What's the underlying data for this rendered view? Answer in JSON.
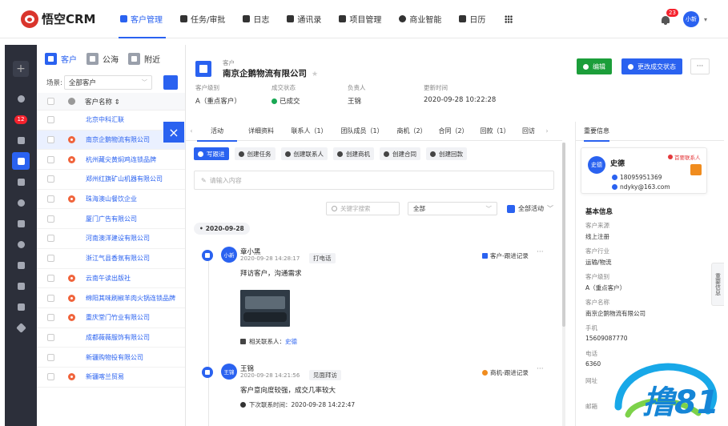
{
  "topnav": {
    "brand": "悟空CRM",
    "items": [
      {
        "label": "客户管理",
        "active": true
      },
      {
        "label": "任务/审批",
        "active": false
      },
      {
        "label": "日志",
        "active": false
      },
      {
        "label": "通讯录",
        "active": false
      },
      {
        "label": "项目管理",
        "active": false
      },
      {
        "label": "商业智能",
        "active": false
      },
      {
        "label": "日历",
        "active": false
      }
    ],
    "notification_count": "23",
    "user_avatar": "小新"
  },
  "sidebar": {
    "badge": "12",
    "icons": [
      "plus-icon",
      "dashboard-icon",
      "badge",
      "transfer-icon",
      "customer-icon",
      "contract-icon",
      "money-icon",
      "invoice-icon",
      "product-icon",
      "ledger-icon",
      "home-icon",
      "box-icon",
      "send-icon"
    ]
  },
  "listpanel": {
    "tabs": [
      "客户",
      "公海",
      "附近"
    ],
    "filter_label": "场景:",
    "filter_value": "全部客户",
    "column_header": "客户名称 ⇕",
    "rows": [
      {
        "name": "北京中科汇联",
        "flag": false,
        "selected": false
      },
      {
        "name": "南京企鹅物流有限公司",
        "flag": true,
        "selected": true
      },
      {
        "name": "杭州藏尖黄焖鸡连锁品牌",
        "flag": true,
        "selected": false
      },
      {
        "name": "郑州红旗矿山机器有限公司",
        "flag": false,
        "selected": false
      },
      {
        "name": "珠海澳山餐饮企业",
        "flag": true,
        "selected": false
      },
      {
        "name": "厦门广告有限公司",
        "flag": false,
        "selected": false
      },
      {
        "name": "河南澳洋建设有限公司",
        "flag": false,
        "selected": false
      },
      {
        "name": "浙江气县香氛有限公司",
        "flag": false,
        "selected": false
      },
      {
        "name": "云南午读出版社",
        "flag": true,
        "selected": false
      },
      {
        "name": "绵阳其味刷椒羊肉火锅连锁品牌",
        "flag": true,
        "selected": false
      },
      {
        "name": "重庆堂门竹业有限公司",
        "flag": true,
        "selected": false
      },
      {
        "name": "成都薇薇服饰有限公司",
        "flag": false,
        "selected": false
      },
      {
        "name": "新疆购物投有限公司",
        "flag": false,
        "selected": false
      },
      {
        "name": "新疆喀兰贸易",
        "flag": true,
        "selected": false
      }
    ],
    "close_icon": "×"
  },
  "detail": {
    "type_label": "客户",
    "name": "南京企鹅物流有限公司",
    "star": "★",
    "fields": [
      {
        "label": "客户级别",
        "value": "A（重点客户）"
      },
      {
        "label": "成交状态",
        "value": "已成交"
      },
      {
        "label": "负责人",
        "value": "王锦"
      },
      {
        "label": "更新时间",
        "value": "2020-09-28 10:22:28"
      }
    ],
    "edit_label": "编辑",
    "status_label": "更改成交状态",
    "more_label": "···",
    "tabs": [
      {
        "label": "活动",
        "active": true
      },
      {
        "label": "详细资料",
        "active": false
      },
      {
        "label": "联系人（1）",
        "active": false
      },
      {
        "label": "团队成员（1）",
        "active": false
      },
      {
        "label": "商机（2）",
        "active": false
      },
      {
        "label": "合同（2）",
        "active": false
      },
      {
        "label": "回款（1）",
        "active": false
      },
      {
        "label": "回访",
        "active": false
      }
    ],
    "actions": [
      "写跟进",
      "创建任务",
      "创建联系人",
      "创建商机",
      "创建合同",
      "创建回款"
    ],
    "note_placeholder": "请输入内容",
    "keyword_placeholder": "关键字搜索",
    "all_select": "全部",
    "all_activities": "全部活动",
    "date_pill": "2020-09-28",
    "feeds": [
      {
        "avatar": "小新",
        "user": "章小黑",
        "time": "2020-09-28 14:28:17",
        "tag": "打电话",
        "content": "拜访客户，沟通需求",
        "relation": "客户-跟进记录",
        "contact_label": "相关联系人：",
        "contact_name": "史德"
      },
      {
        "avatar": "王锦",
        "user": "王锦",
        "time": "2020-09-28 14:21:56",
        "tag": "见面拜访",
        "content": "客户意向度较强，成交几率较大",
        "relation": "商机-跟进记录",
        "next_label": "下次联系时间：",
        "next_time": "2020-09-28 14:22:47"
      }
    ],
    "more_dots": "···"
  },
  "rightpanel": {
    "tab": "重要信息",
    "contact": {
      "avatar": "史德",
      "name": "史德",
      "tag": "首要联系人",
      "phone": "18095951369",
      "email": "ndyky@163.com"
    },
    "section_title": "基本信息",
    "fields": [
      {
        "label": "客户来源",
        "value": "线上注册"
      },
      {
        "label": "客户行业",
        "value": "运输/物流"
      },
      {
        "label": "客户级别",
        "value": "A（重点客户）"
      },
      {
        "label": "客户名称",
        "value": "南京企鹅物流有限公司"
      },
      {
        "label": "手机",
        "value": "15609087770"
      },
      {
        "label": "电话",
        "value": "6360"
      },
      {
        "label": "网址",
        "value": ""
      },
      {
        "label": "邮箱",
        "value": ""
      }
    ],
    "side_tab": "重要信息"
  },
  "watermark": {
    "text": "撸81"
  },
  "colors": {
    "primary": "#2a62f0",
    "success": "#1c9e3a",
    "danger": "#f5222d",
    "sidebar": "#2c2f3a"
  }
}
